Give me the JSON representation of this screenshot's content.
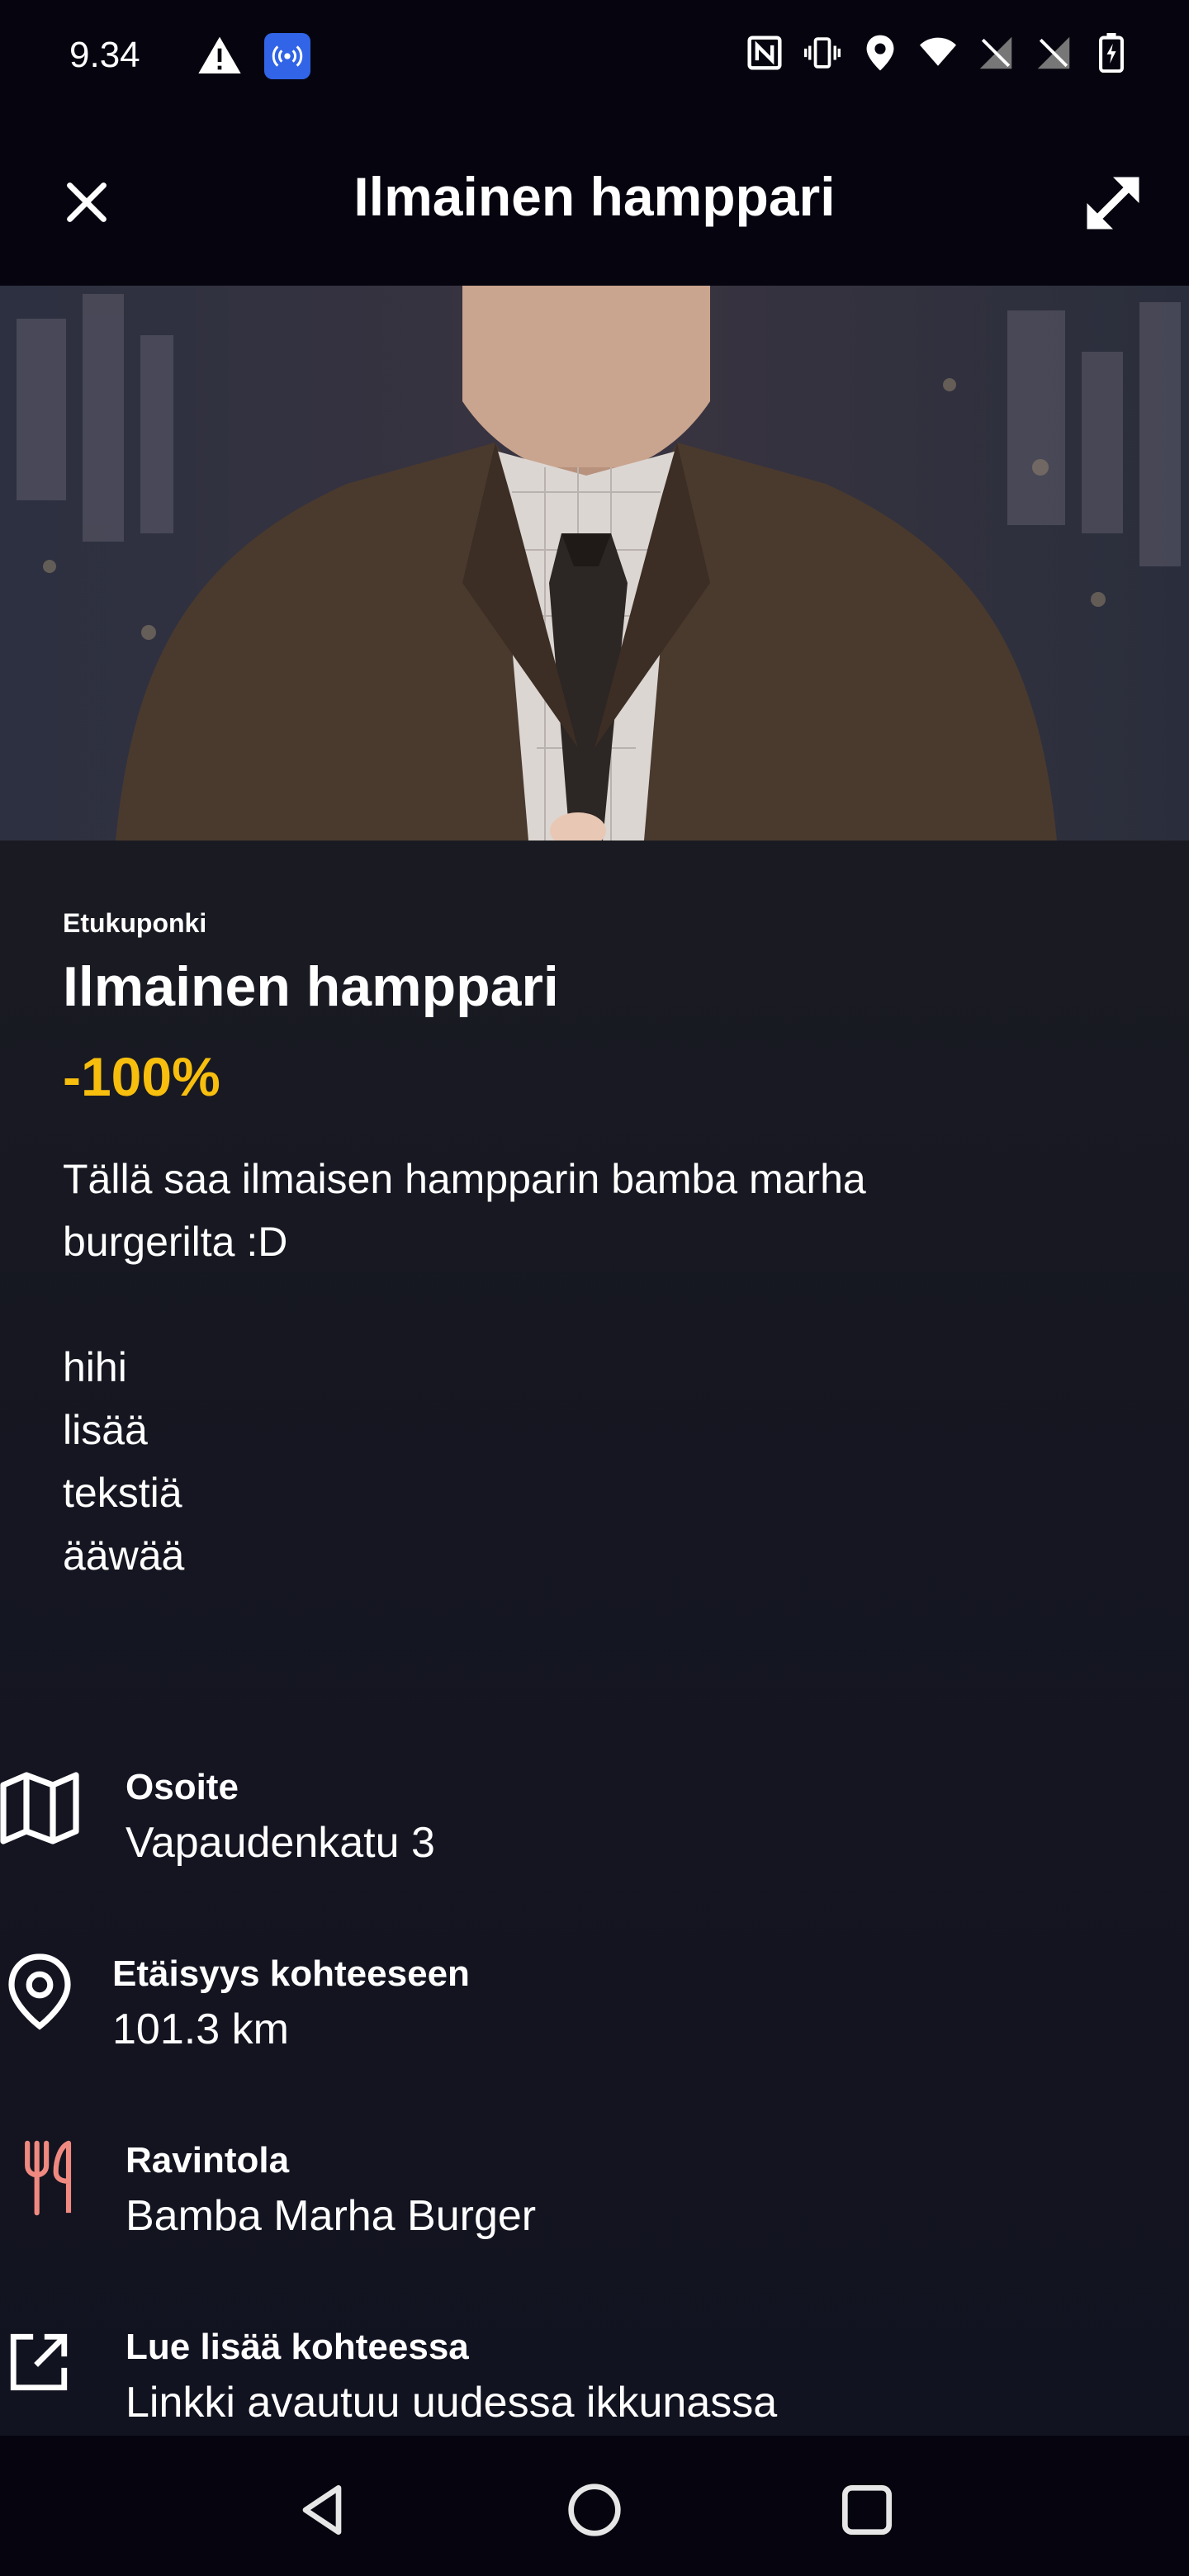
{
  "status_bar": {
    "time": "9.34",
    "icons": [
      "warning-icon",
      "hotspot-icon",
      "nfc-icon",
      "vibrate-icon",
      "location-icon",
      "wifi-icon",
      "no-signal-icon",
      "no-signal-icon",
      "battery-icon"
    ]
  },
  "header": {
    "title": "Ilmainen hamppari",
    "close_icon": "close-icon",
    "expand_icon": "expand-icon"
  },
  "coupon": {
    "tag": "Etukuponki",
    "title": "Ilmainen hamppari",
    "discount": "-100%",
    "description": "Tällä saa ilmaisen hampparin bamba marha\nburgerilta :D\n\nhihi\nlisää\ntekstiä\nääwää"
  },
  "info": {
    "address": {
      "label": "Osoite",
      "value": "Vapaudenkatu 3",
      "icon": "map-icon"
    },
    "distance": {
      "label": "Etäisyys kohteeseen",
      "value": "101.3 km",
      "icon": "location-pin-icon"
    },
    "restaurant": {
      "label": "Ravintola",
      "value": "Bamba Marha Burger",
      "icon": "cutlery-icon",
      "icon_color": "#f08a80"
    },
    "link": {
      "label": "Lue lisää kohteessa",
      "value": "Linkki avautuu uudessa ikkunassa",
      "icon": "external-link-icon"
    }
  },
  "colors": {
    "accent": "#f7be0e",
    "background": "#06050f"
  },
  "nav": [
    "back-icon",
    "home-icon",
    "recents-icon"
  ]
}
